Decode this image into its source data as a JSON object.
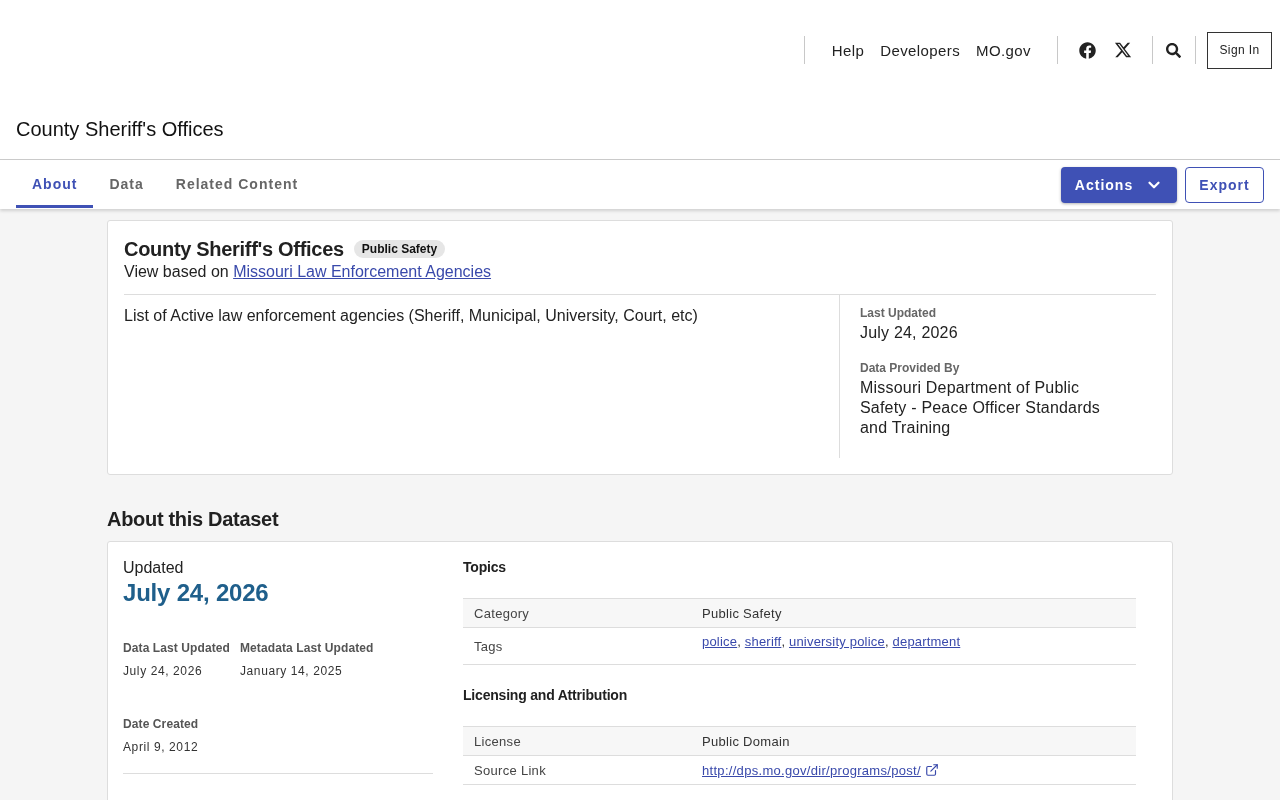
{
  "header": {
    "nav_links": [
      "Help",
      "Developers",
      "MO.gov"
    ],
    "sign_in": "Sign In"
  },
  "page_title": "County Sheriff's Offices",
  "tabs": [
    {
      "label": "About",
      "selected": true
    },
    {
      "label": "Data",
      "selected": false
    },
    {
      "label": "Related Content",
      "selected": false
    }
  ],
  "actions": [
    {
      "label": "Actions",
      "kind": "dropdown"
    },
    {
      "label": "Export",
      "kind": "outline"
    }
  ],
  "summary_card": {
    "title": "County Sheriff's Offices",
    "category_badge": "Public Safety",
    "view_based_on": {
      "prefix": "View based on",
      "link": "Missouri Law Enforcement Agencies"
    },
    "description": "List of Active law enforcement agencies (Sheriff, Municipal, University, Court, etc)",
    "meta": [
      {
        "label": "Last Updated",
        "value": "July 24, 2026"
      },
      {
        "label": "Data Provided By",
        "value": "Missouri Department of Public Safety - Peace Officer Standards and Training"
      }
    ]
  },
  "about_section": {
    "heading": "About this Dataset",
    "updated": {
      "label": "Updated",
      "value": "July 24, 2026"
    },
    "dates": [
      {
        "label": "Data Last Updated",
        "value": "July 24, 2026"
      },
      {
        "label": "Metadata Last Updated",
        "value": "January 14, 2025"
      },
      {
        "label": "Date Created",
        "value": "April 9, 2012"
      }
    ],
    "sections": [
      {
        "title": "Topics",
        "rows": [
          {
            "label": "Category",
            "kind": "text",
            "value": "Public Safety"
          },
          {
            "label": "Tags",
            "kind": "links",
            "separator": ", ",
            "links": [
              "police",
              "sheriff",
              "university police",
              "department"
            ]
          }
        ]
      },
      {
        "title": "Licensing and Attribution",
        "rows": [
          {
            "label": "License",
            "kind": "text",
            "value": "Public Domain"
          },
          {
            "label": "Source Link",
            "kind": "external_link",
            "value": "http://dps.mo.gov/dir/programs/post/"
          }
        ]
      }
    ]
  }
}
